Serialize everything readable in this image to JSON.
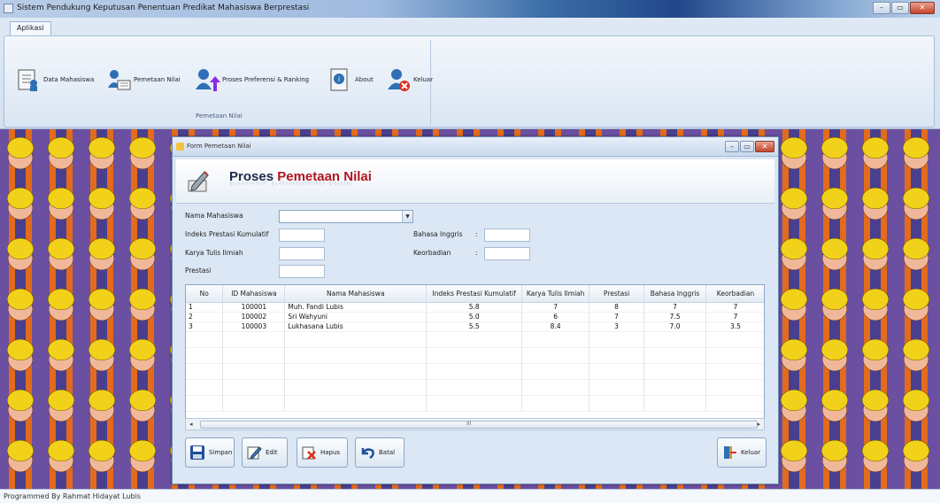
{
  "window": {
    "title": "Sistem Pendukung Keputusan Penentuan Predikat Mahasiswa Berprestasi",
    "min": "–",
    "max": "▭",
    "close": "✕"
  },
  "ribbon": {
    "tab": "Aplikasi",
    "group_label": "Pemetaan Nilai",
    "buttons": [
      {
        "label": "Data Mahasiswa",
        "icon": "student-data-icon"
      },
      {
        "label": "Pemetaan Nilai",
        "icon": "mapping-icon"
      },
      {
        "label": "Proses Preferensi & Ranking",
        "icon": "ranking-icon"
      },
      {
        "label": "About",
        "icon": "about-icon"
      },
      {
        "label": "Keluar",
        "icon": "exit-icon"
      }
    ]
  },
  "child": {
    "title": "Form Pemetaan Nilai",
    "header_part1": "Proses",
    "header_part2": "Pemetaan Nilai",
    "form": {
      "nama_label": "Nama Mahasiswa",
      "nama_value": "",
      "ipk_label": "Indeks Prestasi Kumulatif",
      "kti_label": "Karya Tulis Ilmiah",
      "prestasi_label": "Prestasi",
      "inggris_label": "Bahasa Inggris",
      "inggris_colon": ":",
      "keorganisasian_label": "Keorbadian",
      "keorganisasian_colon": ":"
    },
    "table": {
      "columns": [
        "No",
        "ID Mahasiswa",
        "Nama Mahasiswa",
        "Indeks Prestasi Kumulatif",
        "Karya Tulis Ilmiah",
        "Prestasi",
        "Bahasa Inggris",
        "Keorbadian"
      ],
      "rows": [
        [
          "1",
          "100001",
          "Muh. Fandi Lubis",
          "5.8",
          "7",
          "8",
          "7",
          "7"
        ],
        [
          "2",
          "100002",
          "Sri Wahyuni",
          "5.0",
          "6",
          "7",
          "7.5",
          "7"
        ],
        [
          "3",
          "100003",
          "Lukhasana Lubis",
          "5.5",
          "8.4",
          "3",
          "7.0",
          "3.5"
        ]
      ],
      "scroll_marker": "III"
    },
    "buttons": {
      "simpan": "Simpan",
      "edit": "Edit",
      "hapus": "Hapus",
      "batal": "Batal",
      "keluar": "Keluar"
    }
  },
  "status": "Programmed By Rahmat Hidayat Lubis",
  "colors": {
    "accent": "#b0171f",
    "title_blue": "#1e2b48",
    "panel": "#dbe7f4"
  }
}
